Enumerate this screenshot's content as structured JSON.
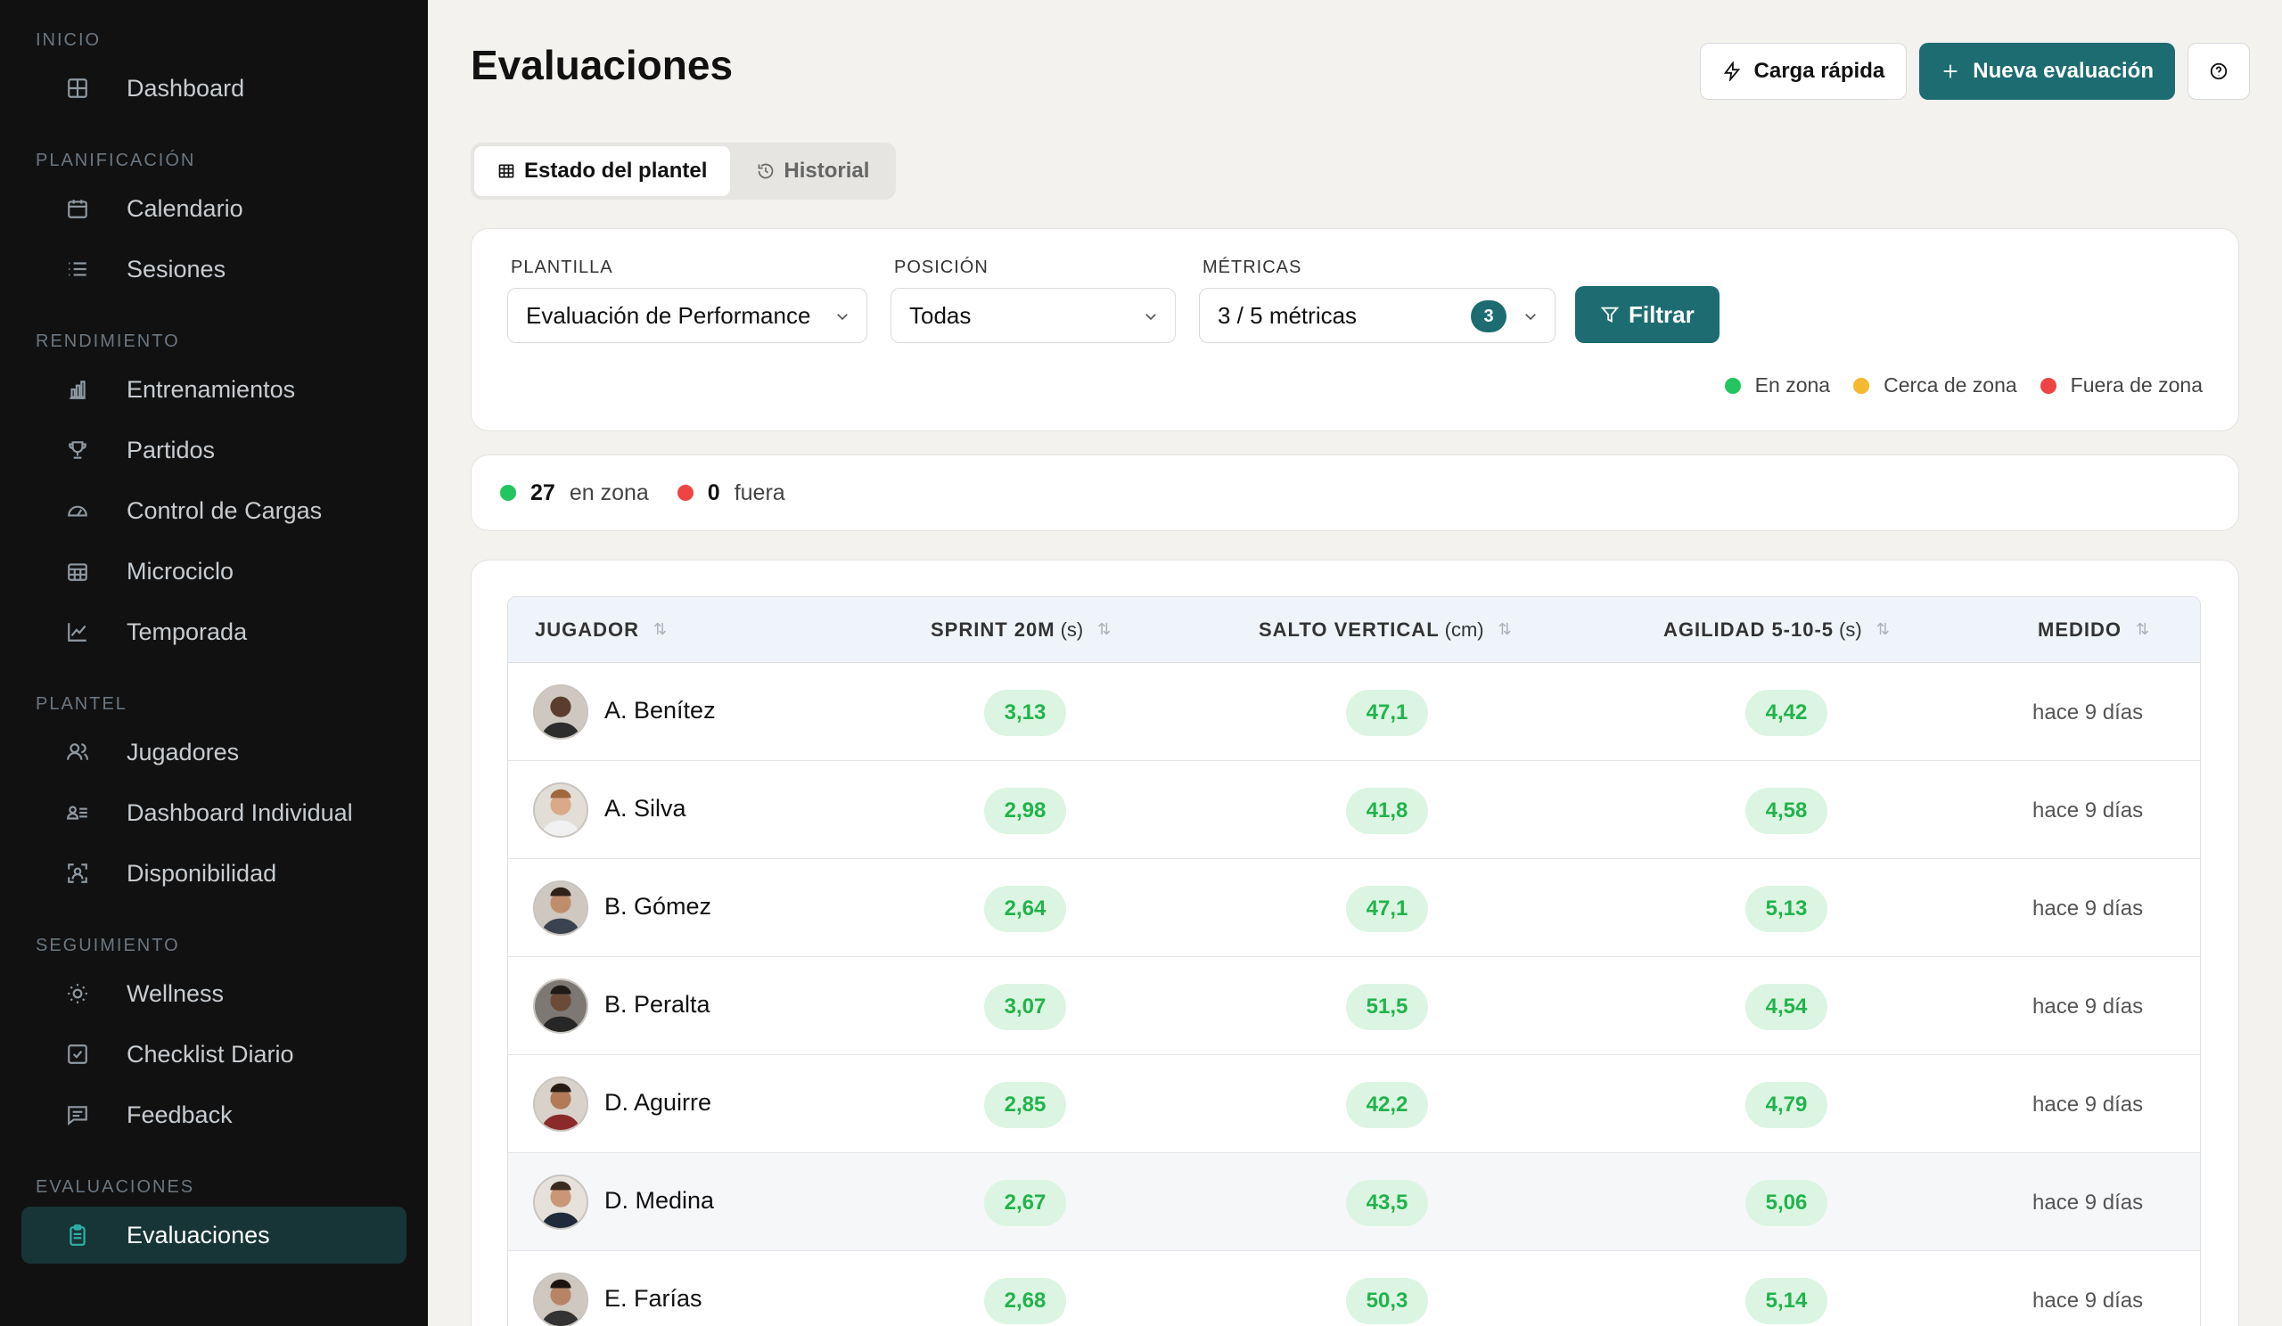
{
  "sidebar": {
    "sections": [
      {
        "title": "INICIO",
        "items": [
          {
            "label": "Dashboard",
            "icon": "grid-icon"
          }
        ]
      },
      {
        "title": "PLANIFICACIÓN",
        "items": [
          {
            "label": "Calendario",
            "icon": "calendar-icon"
          },
          {
            "label": "Sesiones",
            "icon": "list-icon"
          }
        ]
      },
      {
        "title": "RENDIMIENTO",
        "items": [
          {
            "label": "Entrenamientos",
            "icon": "bar-chart-icon"
          },
          {
            "label": "Partidos",
            "icon": "trophy-icon"
          },
          {
            "label": "Control de Cargas",
            "icon": "gauge-icon"
          },
          {
            "label": "Microciclo",
            "icon": "calendar-grid-icon"
          },
          {
            "label": "Temporada",
            "icon": "line-chart-icon"
          }
        ]
      },
      {
        "title": "PLANTEL",
        "items": [
          {
            "label": "Jugadores",
            "icon": "users-icon"
          },
          {
            "label": "Dashboard Individual",
            "icon": "user-list-icon"
          },
          {
            "label": "Disponibilidad",
            "icon": "scan-user-icon"
          }
        ]
      },
      {
        "title": "SEGUIMIENTO",
        "items": [
          {
            "label": "Wellness",
            "icon": "sun-icon"
          },
          {
            "label": "Checklist Diario",
            "icon": "check-square-icon"
          },
          {
            "label": "Feedback",
            "icon": "message-icon"
          }
        ]
      },
      {
        "title": "EVALUACIONES",
        "items": [
          {
            "label": "Evaluaciones",
            "icon": "clipboard-icon",
            "active": true
          }
        ]
      }
    ]
  },
  "header": {
    "title": "Evaluaciones",
    "quick_load_label": "Carga rápida",
    "new_eval_label": "Nueva evaluación"
  },
  "tabs": [
    {
      "label": "Estado del plantel",
      "active": true
    },
    {
      "label": "Historial",
      "active": false
    }
  ],
  "filters": {
    "template_label": "PLANTILLA",
    "template_value": "Evaluación de Performance",
    "position_label": "POSICIÓN",
    "position_value": "Todas",
    "metrics_label": "MÉTRICAS",
    "metrics_value": "3 / 5 métricas",
    "metrics_count": "3",
    "filter_button": "Filtrar"
  },
  "legend": [
    {
      "label": "En zona",
      "color": "#22c55e"
    },
    {
      "label": "Cerca de zona",
      "color": "#f5b82e"
    },
    {
      "label": "Fuera de zona",
      "color": "#ef4444"
    }
  ],
  "summary": {
    "in_zone_count": "27",
    "in_zone_label": "en zona",
    "out_count": "0",
    "out_label": "fuera"
  },
  "table": {
    "columns": [
      {
        "label": "JUGADOR",
        "unit": ""
      },
      {
        "label": "SPRINT 20M",
        "unit": "(s)"
      },
      {
        "label": "SALTO VERTICAL",
        "unit": "(cm)"
      },
      {
        "label": "AGILIDAD 5-10-5",
        "unit": "(s)"
      },
      {
        "label": "MEDIDO",
        "unit": ""
      }
    ],
    "rows": [
      {
        "name": "A. Benítez",
        "sprint": "3,13",
        "salto": "47,1",
        "agilidad": "4,42",
        "medido": "hace 9 días"
      },
      {
        "name": "A. Silva",
        "sprint": "2,98",
        "salto": "41,8",
        "agilidad": "4,58",
        "medido": "hace 9 días"
      },
      {
        "name": "B. Gómez",
        "sprint": "2,64",
        "salto": "47,1",
        "agilidad": "5,13",
        "medido": "hace 9 días"
      },
      {
        "name": "B. Peralta",
        "sprint": "3,07",
        "salto": "51,5",
        "agilidad": "4,54",
        "medido": "hace 9 días"
      },
      {
        "name": "D. Aguirre",
        "sprint": "2,85",
        "salto": "42,2",
        "agilidad": "4,79",
        "medido": "hace 9 días"
      },
      {
        "name": "D. Medina",
        "sprint": "2,67",
        "salto": "43,5",
        "agilidad": "5,06",
        "medido": "hace 9 días"
      },
      {
        "name": "E. Farías",
        "sprint": "2,68",
        "salto": "50,3",
        "agilidad": "5,14",
        "medido": "hace 9 días"
      }
    ]
  }
}
